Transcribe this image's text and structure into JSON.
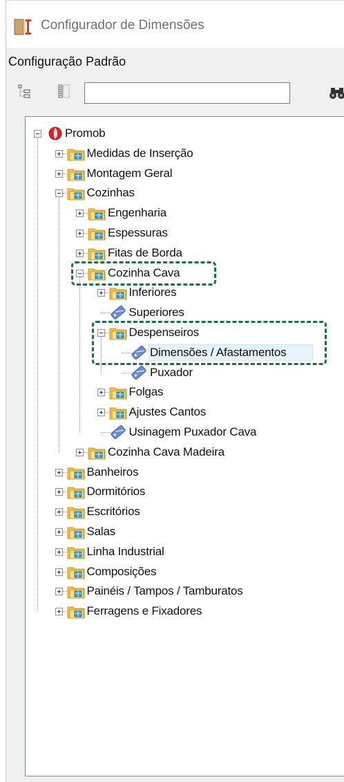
{
  "window": {
    "title": "Configurador de Dimensões",
    "app_icon": "ruler-book-icon"
  },
  "config_bar": {
    "label": "Configuração Padrão"
  },
  "toolbar": {
    "buttons": [
      "tree-structure-icon",
      "list-view-icon"
    ],
    "search_value": "",
    "find_icon": "binoculars-icon"
  },
  "tree": {
    "root": "Promob",
    "items": [
      {
        "label": "Medidas de Inserção"
      },
      {
        "label": "Montagem Geral"
      },
      {
        "label": "Cozinhas"
      },
      {
        "label": "Engenharia"
      },
      {
        "label": "Espessuras"
      },
      {
        "label": "Fitas de Borda"
      },
      {
        "label": "Cozinha Cava"
      },
      {
        "label": "Inferiores"
      },
      {
        "label": "Superiores"
      },
      {
        "label": "Despenseiros"
      },
      {
        "label": "Dimensões / Afastamentos"
      },
      {
        "label": "Puxador"
      },
      {
        "label": "Folgas"
      },
      {
        "label": "Ajustes Cantos"
      },
      {
        "label": "Usinagem Puxador Cava"
      },
      {
        "label": "Cozinha Cava Madeira"
      },
      {
        "label": "Banheiros"
      },
      {
        "label": "Dormitórios"
      },
      {
        "label": "Escritórios"
      },
      {
        "label": "Salas"
      },
      {
        "label": "Linha Industrial"
      },
      {
        "label": "Composições"
      },
      {
        "label": "Painéis / Tampos / Tamburatos"
      },
      {
        "label": "Ferragens e Fixadores"
      }
    ]
  },
  "colors": {
    "highlight": "#1f6b4d",
    "folder": "#f3c244",
    "tag": "#6a8fd8"
  }
}
